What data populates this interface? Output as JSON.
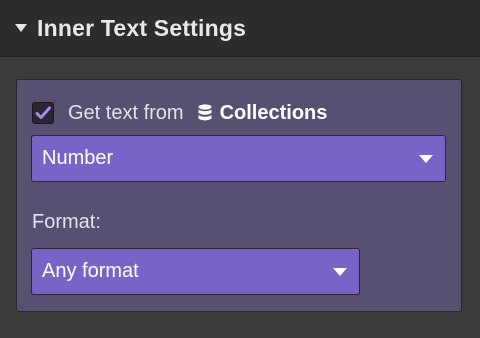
{
  "header": {
    "title": "Inner Text Settings",
    "caret_icon": "caret-down-icon"
  },
  "source": {
    "checkbox_checked": true,
    "get_text_label": "Get text from",
    "db_icon": "database-icon",
    "source_name": "Collections",
    "field_select": {
      "value": "Number"
    }
  },
  "format": {
    "label": "Format:",
    "select": {
      "value": "Any format"
    }
  },
  "colors": {
    "accent": "#7a63c6",
    "section_bg": "#585070",
    "header_bg": "#2c2c2c"
  }
}
